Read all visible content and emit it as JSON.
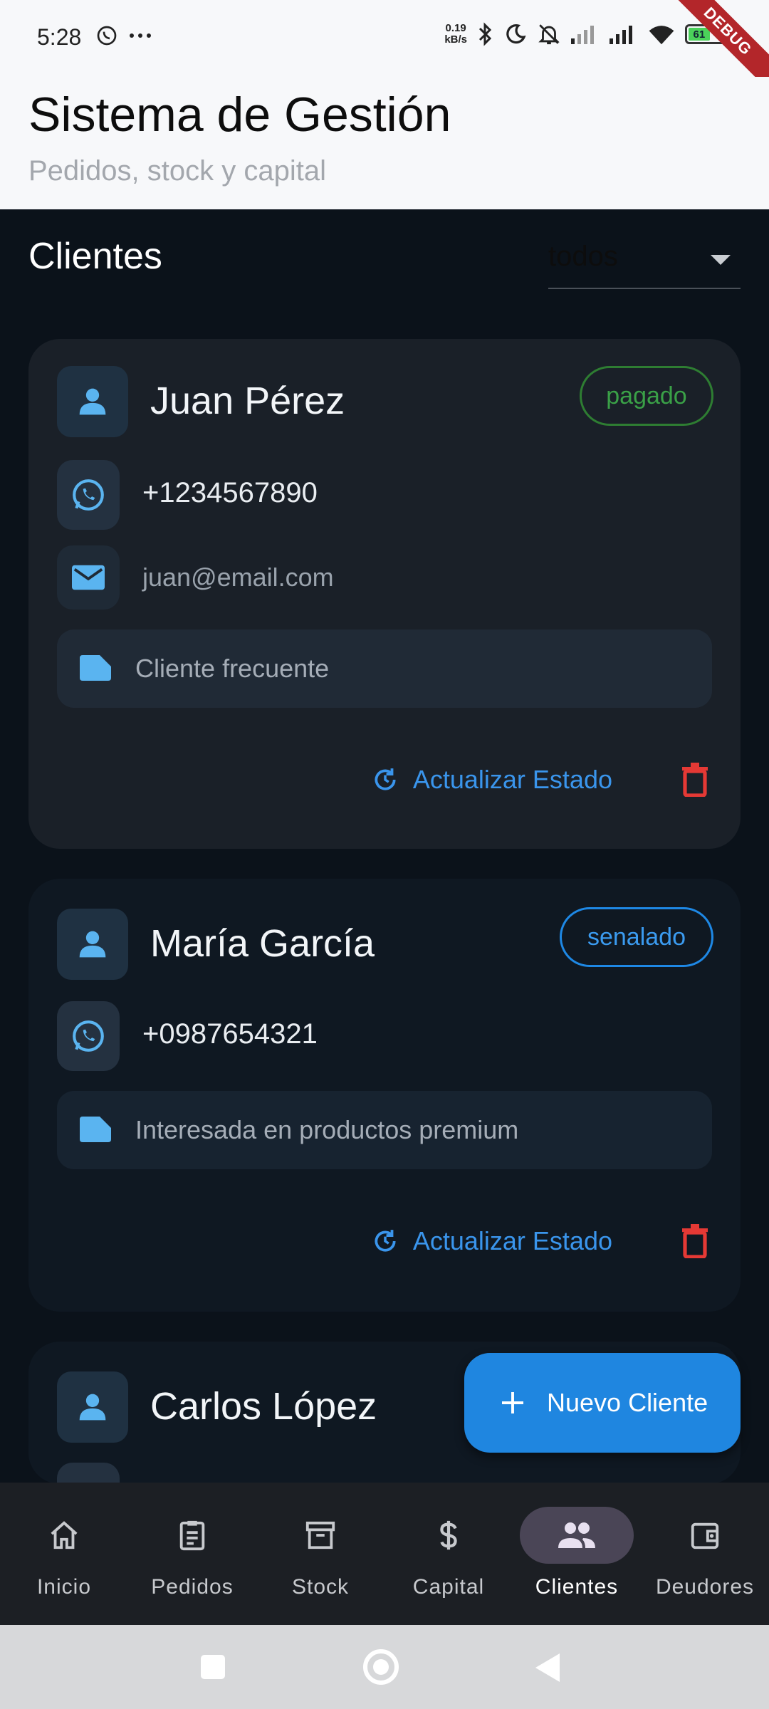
{
  "status_bar": {
    "time": "5:28",
    "speed_value": "0.19",
    "speed_unit": "kB/s",
    "battery": "61",
    "debug_label": "DEBUG"
  },
  "header": {
    "title": "Sistema de Gestión",
    "subtitle": "Pedidos, stock y capital"
  },
  "section": {
    "title": "Clientes",
    "filter_value": "todos"
  },
  "clients": [
    {
      "name": "Juan Pérez",
      "status": "pagado",
      "phone": "+1234567890",
      "email": "juan@email.com",
      "note": "Cliente frecuente",
      "update_label": "Actualizar Estado"
    },
    {
      "name": "María García",
      "status": "senalado",
      "phone": "+0987654321",
      "note": "Interesada en productos premium",
      "update_label": "Actualizar Estado"
    },
    {
      "name": "Carlos López"
    }
  ],
  "fab": {
    "label": "Nuevo Cliente"
  },
  "bottom_nav": [
    {
      "label": "Inicio",
      "icon": "home-icon"
    },
    {
      "label": "Pedidos",
      "icon": "clipboard-icon"
    },
    {
      "label": "Stock",
      "icon": "archive-box-icon"
    },
    {
      "label": "Capital",
      "icon": "dollar-icon"
    },
    {
      "label": "Clientes",
      "icon": "people-icon",
      "active": true
    },
    {
      "label": "Deudores",
      "icon": "wallet-icon"
    }
  ],
  "colors": {
    "accent": "#1f86e0",
    "paid": "#3aa047",
    "delete": "#e53935",
    "background": "#0b121a"
  }
}
